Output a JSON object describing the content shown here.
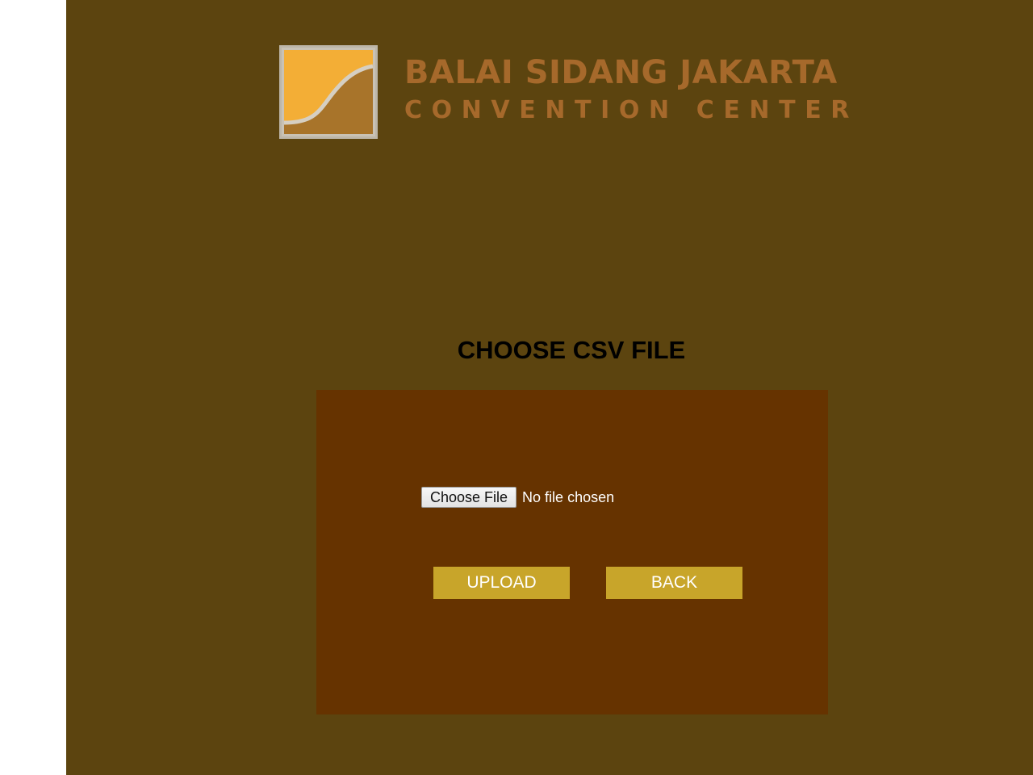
{
  "logo": {
    "line1": "BALAI SIDANG JAKARTA",
    "line2": "CONVENTION CENTER"
  },
  "page_title": "CHOOSE CSV FILE",
  "file_input": {
    "button_label": "Choose File",
    "status_text": "No file chosen"
  },
  "actions": {
    "upload_label": "UPLOAD",
    "back_label": "BACK"
  },
  "colors": {
    "page_background": "#5c440f",
    "panel_background": "#663300",
    "button_background": "#c8a52a",
    "logo_text": "#a6692b",
    "logo_orange": "#f3ae36"
  }
}
